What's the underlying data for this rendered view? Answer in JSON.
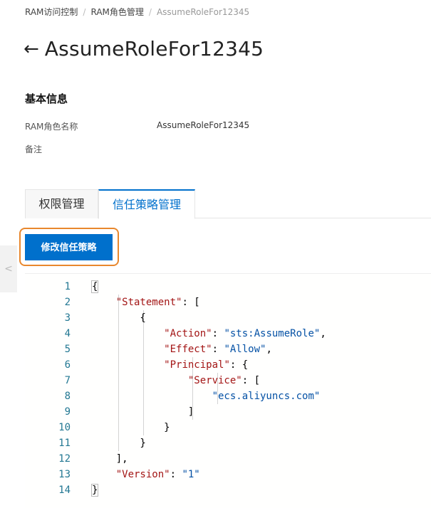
{
  "breadcrumb": {
    "items": [
      "RAM访问控制",
      "RAM角色管理"
    ],
    "current": "AssumeRoleFor12345",
    "separator": "/"
  },
  "header": {
    "back_icon": "←",
    "title": "AssumeRoleFor12345"
  },
  "basic_info": {
    "section_title": "基本信息",
    "fields": [
      {
        "label": "RAM角色名称",
        "value": "AssumeRoleFor12345"
      },
      {
        "label": "备注",
        "value": ""
      }
    ]
  },
  "tabs": [
    {
      "label": "权限管理",
      "active": false
    },
    {
      "label": "信任策略管理",
      "active": true
    }
  ],
  "toolbar": {
    "edit_button_label": "修改信任策略"
  },
  "side_handle": {
    "icon": "<"
  },
  "editor": {
    "lines": [
      {
        "n": "1",
        "tokens": [
          [
            "p",
            "{"
          ]
        ]
      },
      {
        "n": "2",
        "tokens": [
          [
            "p",
            "    "
          ],
          [
            "k",
            "\"Statement\""
          ],
          [
            "p",
            ": ["
          ]
        ]
      },
      {
        "n": "3",
        "tokens": [
          [
            "p",
            "        {"
          ]
        ]
      },
      {
        "n": "4",
        "tokens": [
          [
            "p",
            "            "
          ],
          [
            "k",
            "\"Action\""
          ],
          [
            "p",
            ": "
          ],
          [
            "s",
            "\"sts:AssumeRole\""
          ],
          [
            "p",
            ","
          ]
        ]
      },
      {
        "n": "5",
        "tokens": [
          [
            "p",
            "            "
          ],
          [
            "k",
            "\"Effect\""
          ],
          [
            "p",
            ": "
          ],
          [
            "s",
            "\"Allow\""
          ],
          [
            "p",
            ","
          ]
        ]
      },
      {
        "n": "6",
        "tokens": [
          [
            "p",
            "            "
          ],
          [
            "k",
            "\"Principal\""
          ],
          [
            "p",
            ": {"
          ]
        ]
      },
      {
        "n": "7",
        "tokens": [
          [
            "p",
            "                "
          ],
          [
            "k",
            "\"Service\""
          ],
          [
            "p",
            ": ["
          ]
        ]
      },
      {
        "n": "8",
        "tokens": [
          [
            "p",
            "                    "
          ],
          [
            "s",
            "\"ecs.aliyuncs.com\""
          ]
        ]
      },
      {
        "n": "9",
        "tokens": [
          [
            "p",
            "                ]"
          ]
        ]
      },
      {
        "n": "10",
        "tokens": [
          [
            "p",
            "            }"
          ]
        ]
      },
      {
        "n": "11",
        "tokens": [
          [
            "p",
            "        }"
          ]
        ]
      },
      {
        "n": "12",
        "tokens": [
          [
            "p",
            "    ],"
          ]
        ]
      },
      {
        "n": "13",
        "tokens": [
          [
            "p",
            "    "
          ],
          [
            "k",
            "\"Version\""
          ],
          [
            "p",
            ": "
          ],
          [
            "s",
            "\"1\""
          ]
        ]
      },
      {
        "n": "14",
        "tokens": [
          [
            "p",
            "}"
          ]
        ]
      }
    ]
  }
}
